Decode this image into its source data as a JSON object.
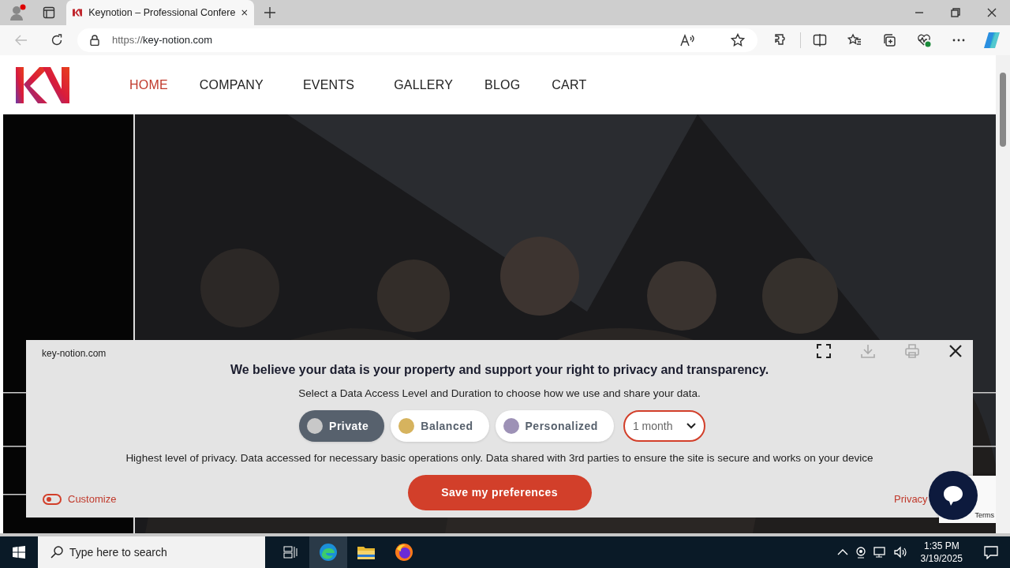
{
  "browser": {
    "tabs": [
      {
        "title": "Keynotion – Professional Confere",
        "selected": true
      }
    ],
    "url_scheme": "https://",
    "url_host": "key-notion.com"
  },
  "site": {
    "nav": [
      {
        "label": "HOME",
        "selected": true
      },
      {
        "label": "COMPANY",
        "selected": false
      },
      {
        "label": "EVENTS",
        "selected": false
      },
      {
        "label": "GALLERY",
        "selected": false
      },
      {
        "label": "BLOG",
        "selected": false
      },
      {
        "label": "CART",
        "selected": false
      }
    ]
  },
  "consent": {
    "site": "key-notion.com",
    "heading": "We believe your data is your property and support your right to privacy and transparency.",
    "subheading": "Select a Data Access Level and Duration to choose how we use and share your data.",
    "levels": [
      {
        "label": "Private",
        "color": "#c8c8c8",
        "selected": true
      },
      {
        "label": "Balanced",
        "color": "#d6b35e",
        "selected": false
      },
      {
        "label": "Personalized",
        "color": "#9d91b6",
        "selected": false
      }
    ],
    "duration": "1 month",
    "description": "Highest level of privacy. Data accessed for necessary basic operations only. Data shared with 3rd parties to ensure the site is secure and works on your device",
    "customize": {
      "label": "Customize",
      "on": false
    },
    "save": "Save my preferences",
    "privacy": "Privacy"
  },
  "recaptcha": {
    "terms": "Terms"
  },
  "taskbar": {
    "search_placeholder": "Type here to search",
    "time": "1:35 PM",
    "date": "3/19/2025"
  }
}
